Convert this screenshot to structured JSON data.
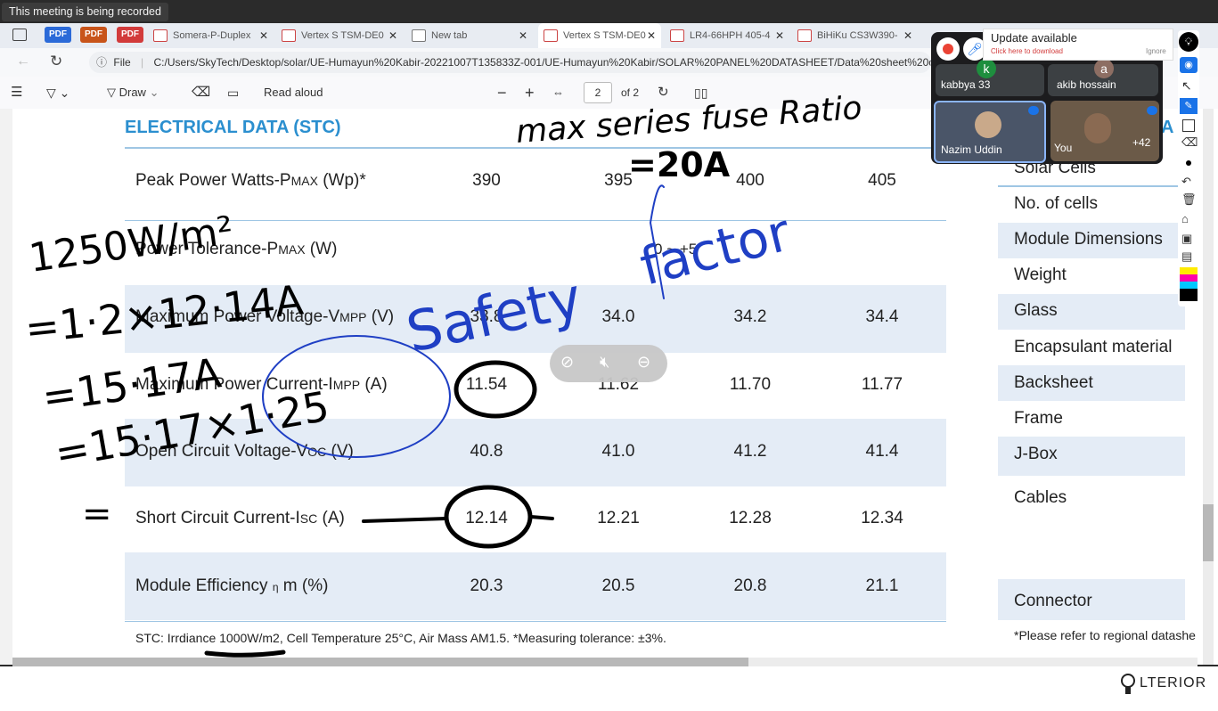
{
  "recording_banner": "This meeting is being recorded",
  "tabs": [
    {
      "label": "PDF",
      "kind": "chip",
      "color": "#2b6ad8"
    },
    {
      "label": "PDF",
      "kind": "chip",
      "color": "#c8541a"
    },
    {
      "label": "PDF",
      "kind": "chip",
      "color": "#d23b3b"
    },
    {
      "label": "Somera-P-Duplex"
    },
    {
      "label": "Vertex S TSM-DE0"
    },
    {
      "label": "New tab"
    },
    {
      "label": "Vertex S TSM-DE0"
    },
    {
      "label": "LR4-66HPH 405-4"
    },
    {
      "label": "BiHiKu CS3W390-"
    }
  ],
  "address": {
    "file_label": "File",
    "url": "C:/Users/SkyTech/Desktop/solar/UE-Humayun%20Kabir-20221007T135833Z-001/UE-Humayun%20Kabir/SOLAR%20PANEL%20DATASHEET/Data%20sheet%20o"
  },
  "pdf_toolbar": {
    "draw": "Draw",
    "read_aloud": "Read aloud",
    "minus": "−",
    "plus": "+",
    "page": "2",
    "of_pages": "of 2"
  },
  "document": {
    "title": "ELECTRICAL DATA (STC)",
    "rows": [
      {
        "label": "Peak Power Watts-P",
        "sub": "MAX",
        "suffix": " (Wp)*",
        "values": [
          "390",
          "395",
          "400",
          "405"
        ]
      },
      {
        "label": "Power Tolerance-P",
        "sub": "MAX",
        "suffix": " (W)",
        "values": [
          "0 ~ +5"
        ]
      },
      {
        "label": "Maximum Power Voltage-V",
        "sub": "MPP",
        "suffix": " (V)",
        "values": [
          "33.8",
          "34.0",
          "34.2",
          "34.4"
        ]
      },
      {
        "label": "Maximum Power Current-I",
        "sub": "MPP",
        "suffix": " (A)",
        "values": [
          "11.54",
          "11.62",
          "11.70",
          "11.77"
        ]
      },
      {
        "label": "Open Circuit Voltage-V",
        "sub": "OC",
        "suffix": " (V)",
        "values": [
          "40.8",
          "41.0",
          "41.2",
          "41.4"
        ]
      },
      {
        "label": "Short Circuit Current-I",
        "sub": "SC",
        "suffix": " (A)",
        "values": [
          "12.14",
          "12.21",
          "12.28",
          "12.34"
        ]
      },
      {
        "label": "Module Efficiency",
        "sub": "η",
        "suffix": " m (%)",
        "values": [
          "20.3",
          "20.5",
          "20.8",
          "21.1"
        ]
      }
    ],
    "footnote": "STC: Irrdiance 1000W/m2, Cell Temperature 25°C, Air Mass AM1.5.   *Measuring tolerance: ±3%.",
    "right_column": [
      "Solar Cells",
      "No. of cells",
      "Module Dimensions",
      "Weight",
      "Glass",
      "Encapsulant material",
      "Backsheet",
      "Frame",
      "J-Box",
      "Cables",
      "Connector"
    ],
    "right_footnote": "*Please refer to regional datashe",
    "right_header_fragment": "A"
  },
  "handwriting": {
    "top": "max series fuse Ratio",
    "eq": "=20A",
    "l1": "1250W/m²",
    "l2": "=1·2×12·14A",
    "l3": "=15·17A",
    "l4": "=15·17×1·25",
    "l5": "=",
    "safety": "Safety",
    "factor": "factor"
  },
  "meet": {
    "update_title": "Update available",
    "update_sub": "Click here to download",
    "update_ignore": "Ignore",
    "participants": [
      {
        "name": "kabbya 33",
        "initial": "k",
        "color": "#1e8e3e"
      },
      {
        "name": "akib hossain",
        "initial": "a",
        "color": "#8d6e63"
      },
      {
        "name": "Nazim Uddin"
      },
      {
        "name": "You"
      }
    ],
    "more_count": "+42"
  },
  "brand": "LTERIOR",
  "colors": {
    "accent": "#2b8fcf",
    "row_shade": "#e4ecf6",
    "ink_blue": "#1f3fc4"
  }
}
